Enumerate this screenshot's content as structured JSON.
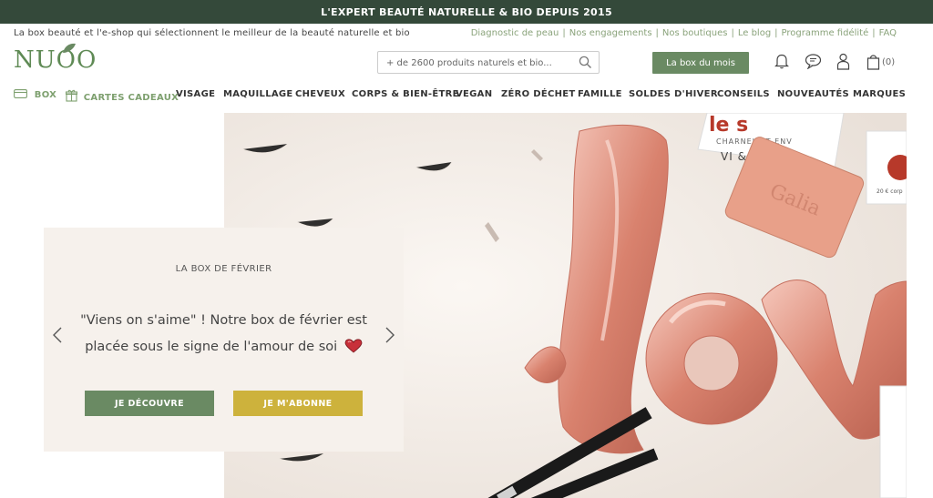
{
  "topbar": {
    "text": "L'EXPERT BEAUTÉ NATURELLE & BIO DEPUIS 2015"
  },
  "subheader": {
    "tagline": "La box beauté et l'e-shop qui sélectionnent le meilleur de la beauté naturelle et bio",
    "links": [
      "Diagnostic de peau",
      "Nos engagements",
      "Nos boutiques",
      "Le blog",
      "Programme fidélité",
      "FAQ"
    ]
  },
  "header": {
    "logo": "NUOO",
    "search": {
      "placeholder": "+ de 2600 produits naturels et bio..."
    },
    "box_button": "La box du mois",
    "cart_count": "(0)"
  },
  "nav": {
    "items": [
      {
        "label": "BOX",
        "icon": "box-icon"
      },
      {
        "label": "CARTES CADEAUX",
        "icon": "gift-icon"
      },
      {
        "label": "VISAGE"
      },
      {
        "label": "MAQUILLAGE"
      },
      {
        "label": "CHEVEUX"
      },
      {
        "label": "CORPS & BIEN-ÊTRE"
      },
      {
        "label": "VEGAN"
      },
      {
        "label": "ZÉRO DÉCHET"
      },
      {
        "label": "FAMILLE"
      },
      {
        "label": "SOLDES D'HIVER"
      },
      {
        "label": "CONSEILS"
      },
      {
        "label": "NOUVEAUTÉS"
      },
      {
        "label": "MARQUES"
      }
    ]
  },
  "hero": {
    "kicker": "LA BOX DE FÉVRIER",
    "quote_line1": "\"Viens on s'aime\" ! Notre box de février est",
    "quote_line2": "placée sous le signe de l'amour de soi",
    "primary_button": "JE DÉCOUVRE",
    "secondary_button": "JE M'ABONNE",
    "image_texts": {
      "soap_brand": "Galia",
      "box_text_1": "le s",
      "box_text_2": "CHARNEL ET ENV",
      "box_text_3": "VI  & CORPS",
      "small_label": "20 € corp"
    }
  },
  "colors": {
    "dark_green": "#34493a",
    "brand_green": "#6a8a63",
    "mustard": "#cdb23c",
    "link_green": "#8aa37b"
  }
}
